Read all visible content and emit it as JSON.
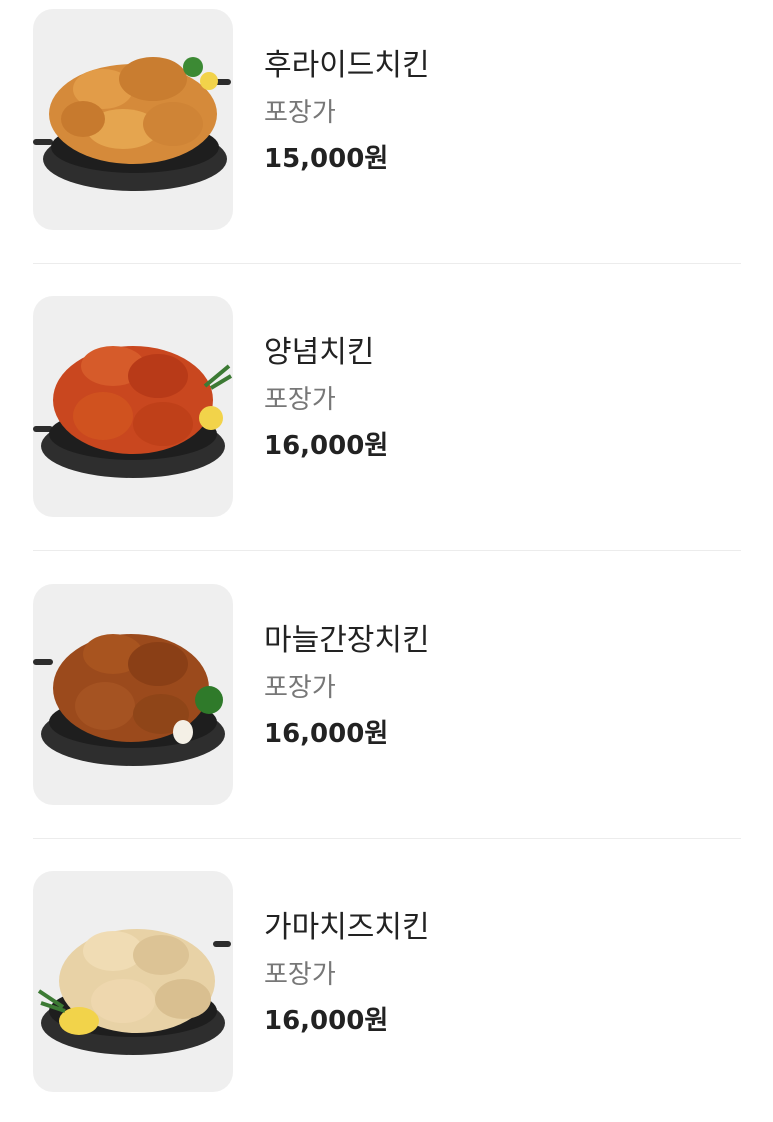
{
  "menu": {
    "items": [
      {
        "name": "후라이드치킨",
        "option": "포장가",
        "price": "15,000원",
        "image_icon": "fried-chicken-icon"
      },
      {
        "name": "양념치킨",
        "option": "포장가",
        "price": "16,000원",
        "image_icon": "seasoned-chicken-icon"
      },
      {
        "name": "마늘간장치킨",
        "option": "포장가",
        "price": "16,000원",
        "image_icon": "garlic-soy-chicken-icon"
      },
      {
        "name": "가마치즈치킨",
        "option": "포장가",
        "price": "16,000원",
        "image_icon": "cheese-chicken-icon"
      }
    ]
  },
  "colors": {
    "thumb_bg": "#efefef",
    "divider": "#ececec",
    "name_text": "#222222",
    "option_text": "#777777",
    "price_text": "#222222",
    "fried": "#d58a3a",
    "seasoned": "#c9471f",
    "garlic_soy": "#9b4a1c",
    "cheese": "#e8d2a6"
  }
}
